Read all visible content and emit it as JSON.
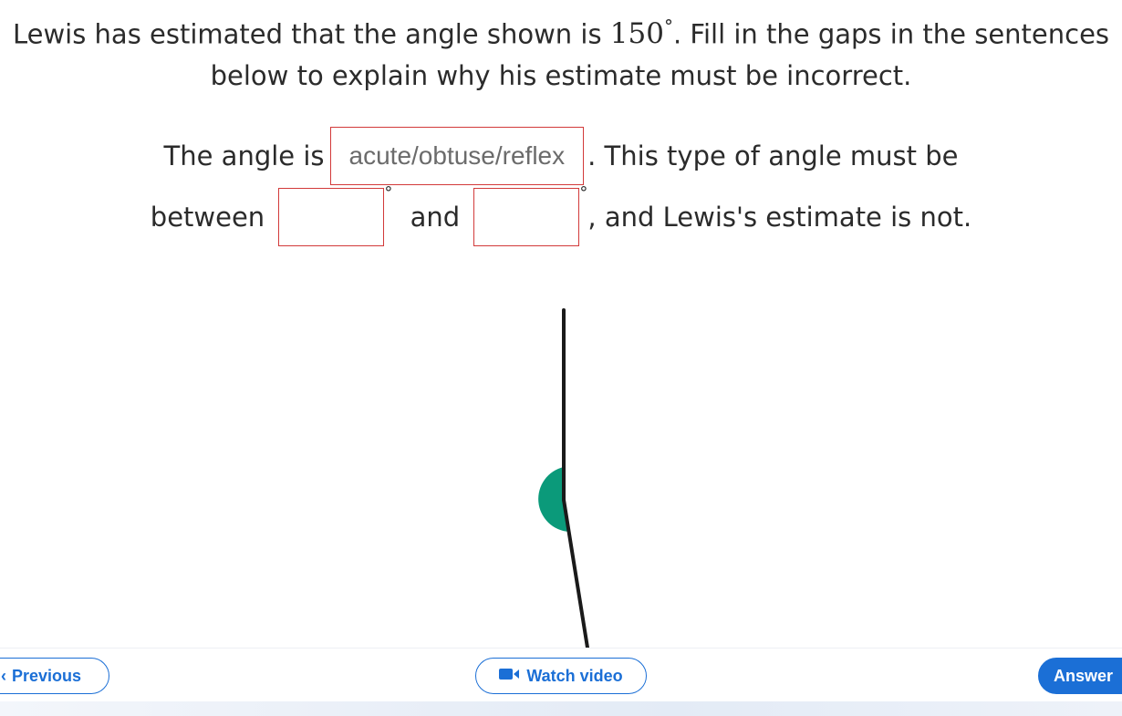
{
  "question": {
    "text_before": "Lewis has estimated that the angle shown is ",
    "estimate_value": "150",
    "degree_symbol": "°",
    "text_after": ". Fill in the gaps in the sentences below to explain why his estimate must be incorrect."
  },
  "sentence": {
    "part1": "The angle is",
    "select_placeholder": "acute/obtuse/reflex",
    "part2": ". This type of angle must be",
    "part3": "between",
    "part4": "and",
    "part5": ", and Lewis's estimate is not.",
    "degree_symbol": "°"
  },
  "diagram": {
    "arc_color": "#0b9a7a",
    "line_color": "#1a1a1a"
  },
  "nav": {
    "previous_label": "Previous",
    "video_label": "Watch video",
    "answer_label": "Answer",
    "accent_color": "#1b6fd6"
  }
}
